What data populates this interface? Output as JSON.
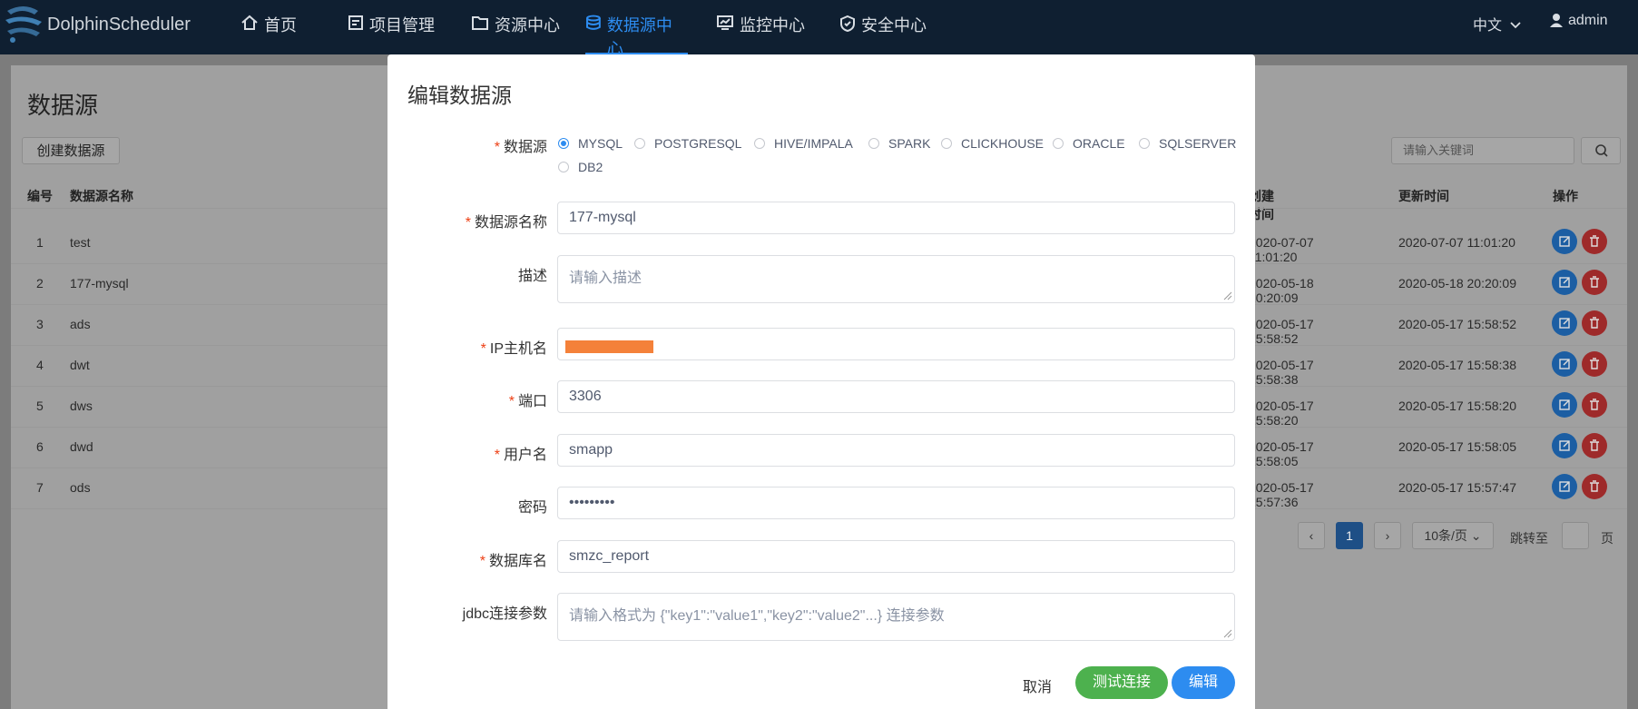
{
  "app": {
    "brand": "DolphinScheduler"
  },
  "nav": {
    "items": [
      {
        "label": "首页",
        "icon": "home-icon"
      },
      {
        "label": "项目管理",
        "icon": "project-icon"
      },
      {
        "label": "资源中心",
        "icon": "folder-icon"
      },
      {
        "label": "数据源中心",
        "icon": "database-icon",
        "active": true
      },
      {
        "label": "监控中心",
        "icon": "monitor-icon"
      },
      {
        "label": "安全中心",
        "icon": "shield-icon"
      }
    ],
    "language": "中文",
    "user": "admin"
  },
  "page": {
    "title": "数据源",
    "create_button": "创建数据源",
    "search_placeholder": "请输入关键词",
    "columns": [
      "编号",
      "数据源名称",
      "创建时间",
      "更新时间",
      "操作"
    ],
    "rows": [
      {
        "id": "1",
        "name": "test",
        "created": "2020-07-07 11:01:20",
        "updated": "2020-07-07 11:01:20"
      },
      {
        "id": "2",
        "name": "177-mysql",
        "created": "2020-05-18 20:20:09",
        "updated": "2020-05-18 20:20:09"
      },
      {
        "id": "3",
        "name": "ads",
        "created": "2020-05-17 15:58:52",
        "updated": "2020-05-17 15:58:52"
      },
      {
        "id": "4",
        "name": "dwt",
        "created": "2020-05-17 15:58:38",
        "updated": "2020-05-17 15:58:38"
      },
      {
        "id": "5",
        "name": "dws",
        "created": "2020-05-17 15:58:20",
        "updated": "2020-05-17 15:58:20"
      },
      {
        "id": "6",
        "name": "dwd",
        "created": "2020-05-17 15:58:05",
        "updated": "2020-05-17 15:58:05"
      },
      {
        "id": "7",
        "name": "ods",
        "created": "2020-05-17 15:57:36",
        "updated": "2020-05-17 15:57:47"
      }
    ],
    "pager": {
      "current": "1",
      "page_size": "10条/页",
      "jump_label": "跳转至",
      "page_unit": "页"
    }
  },
  "modal": {
    "title": "编辑数据源",
    "datasource_label": "数据源",
    "datasource_options": [
      "MYSQL",
      "POSTGRESQL",
      "HIVE/IMPALA",
      "SPARK",
      "CLICKHOUSE",
      "ORACLE",
      "SQLSERVER",
      "DB2"
    ],
    "datasource_selected": "MYSQL",
    "name_label": "数据源名称",
    "name_value": "177-mysql",
    "desc_label": "描述",
    "desc_placeholder": "请输入描述",
    "host_label": "IP主机名",
    "port_label": "端口",
    "port_value": "3306",
    "user_label": "用户名",
    "user_value": "smapp",
    "password_label": "密码",
    "password_value": "•••••••••",
    "db_label": "数据库名",
    "db_value": "smzc_report",
    "jdbc_label": "jdbc连接参数",
    "jdbc_placeholder": "请输入格式为 {\"key1\":\"value1\",\"key2\":\"value2\"...} 连接参数",
    "cancel": "取消",
    "test": "测试连接",
    "submit": "编辑"
  },
  "colors": {
    "accent": "#2d8cf0",
    "success": "#4db14e",
    "required": "#ed3f14",
    "navbar": "#0f1f31"
  }
}
